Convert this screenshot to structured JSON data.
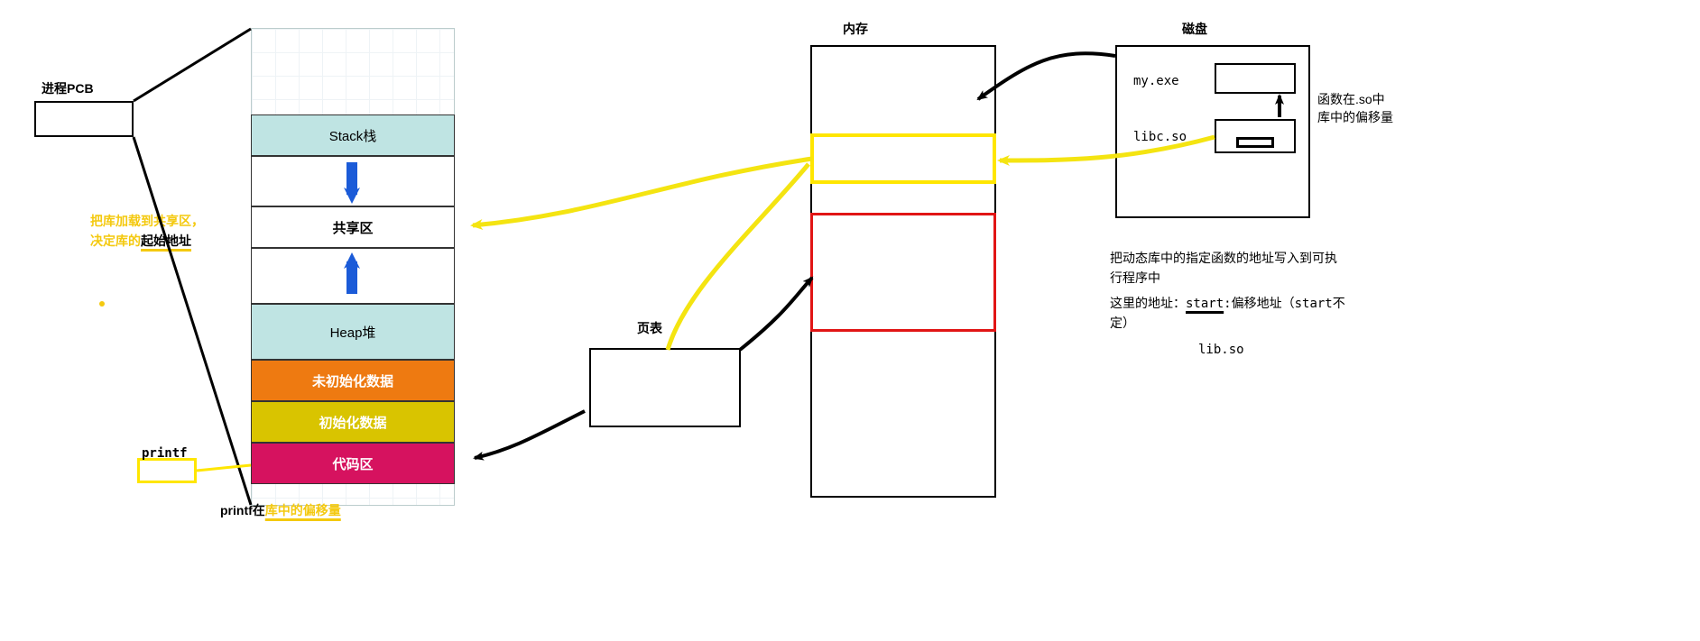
{
  "labels": {
    "pcb": "进程PCB",
    "mem_title": "内存",
    "disk_title": "磁盘",
    "page_table": "页表",
    "printf_tag": "printf",
    "printf_caption_black": "printf在",
    "printf_caption_yellow": "库中的偏移量",
    "load_note_line1": "把库加载到共享区，",
    "load_note_line2_a": "决定库的",
    "load_note_line2_b": "起始地址",
    "disk_file1": "my.exe",
    "disk_file2": "libc.so",
    "disk_right_l1": "函数在.so中",
    "disk_right_l2": "库中的偏移量",
    "disk_desc_l1": "把动态库中的指定函数的地址写入到可执",
    "disk_desc_l2": "行程序中",
    "disk_desc_l3a": "这里的地址：",
    "disk_desc_l3b": "start",
    "disk_desc_l3c": ":偏移地址（start不",
    "disk_desc_l4": "定）",
    "disk_desc_l5": "lib.so"
  },
  "segments": {
    "stack": "Stack栈",
    "shared": "共享区",
    "heap": "Heap堆",
    "bss": "未初始化数据",
    "data": "初始化数据",
    "code": "代码区"
  },
  "colors": {
    "teal": "#bfe4e3",
    "orange": "#ee7a11",
    "olive": "#d9c400",
    "magenta": "#d6125f",
    "yellow": "#ffe600",
    "yellow_stroke": "#f4e411",
    "red": "#e11515",
    "blue": "#1b5bd8"
  }
}
